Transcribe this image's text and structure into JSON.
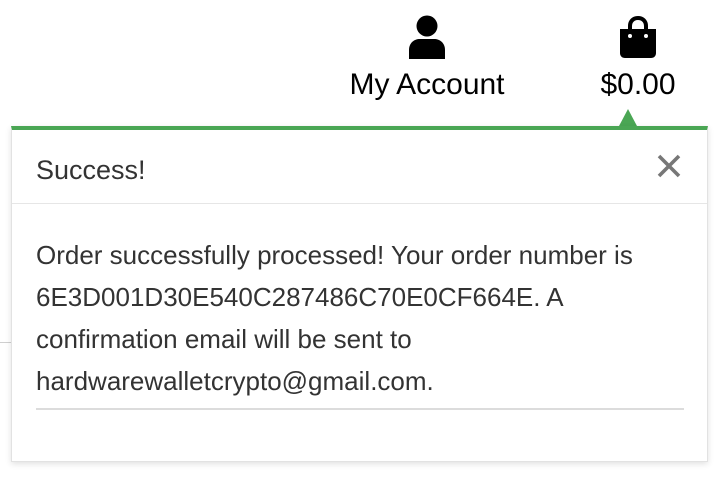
{
  "header": {
    "account_label": "My Account",
    "bag_total": "$0.00",
    "account_icon": "user-icon",
    "bag_icon": "shopping-bag-icon"
  },
  "toast": {
    "title": "Success!",
    "close_icon": "close-icon",
    "message": "Order successfully processed! Your order number is 6E3D001D30E540C287486C70E0CF664E. A confirmation email will be sent to hardwarewalletcrypto@gmail.com.",
    "accent_color": "#4aa654"
  }
}
